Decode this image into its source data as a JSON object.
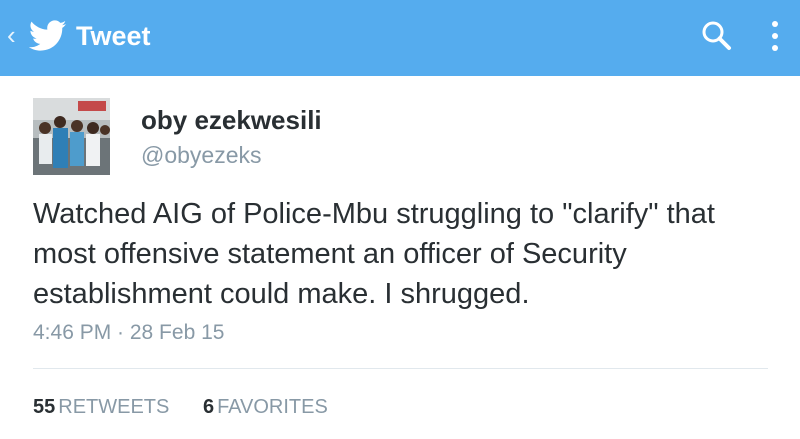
{
  "appbar": {
    "title": "Tweet",
    "back_icon": "chevron-left-icon",
    "logo_icon": "twitter-bird-icon",
    "search_icon": "search-icon",
    "menu_icon": "overflow-menu-icon",
    "background_color": "#55acee"
  },
  "tweet": {
    "display_name": "oby ezekwesili",
    "handle": "@obyezeks",
    "text": "Watched AIG of Police-Mbu struggling to \"clarify\" that most offensive statement an officer of Security establishment could make. I shrugged.",
    "timestamp": "4:46 PM · 28 Feb 15"
  },
  "stats": {
    "retweets_count": "55",
    "retweets_label": "RETWEETS",
    "favorites_count": "6",
    "favorites_label": "FAVORITES"
  }
}
